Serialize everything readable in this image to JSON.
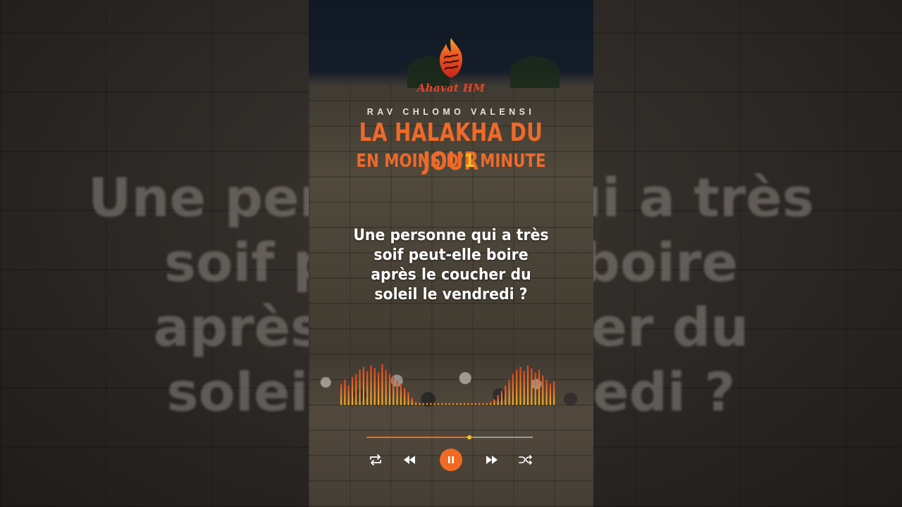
{
  "background_text": {
    "line1": "Une personne qui a très",
    "line2": "soif peut-elle boire",
    "line3": "après le coucher du",
    "line4": "soleil le vendredi ?"
  },
  "logo": {
    "brand": "Ahavat HM",
    "icon": "flame-logo-icon"
  },
  "author": "RAV CHLOMO VALENSI",
  "title": {
    "line1": "LA HALAKHA DU JOUR",
    "line2_prefix": "EN MOINS D’",
    "line2_number": "1",
    "line2_suffix": " MINUTE"
  },
  "question": {
    "line1": "Une personne qui a très",
    "line2": "soif peut-elle boire",
    "line3": "après le coucher du",
    "line4": "soleil le vendredi ?"
  },
  "player": {
    "progress": 0.62,
    "controls": {
      "repeat": "repeat-icon",
      "previous": "rewind-icon",
      "play_pause": "pause-icon",
      "next": "fast-forward-icon",
      "shuffle": "shuffle-icon"
    }
  },
  "colors": {
    "accent_orange": "#ee6a2a",
    "highlight_yellow": "#f6c21a",
    "brand_red": "#e2452a"
  }
}
